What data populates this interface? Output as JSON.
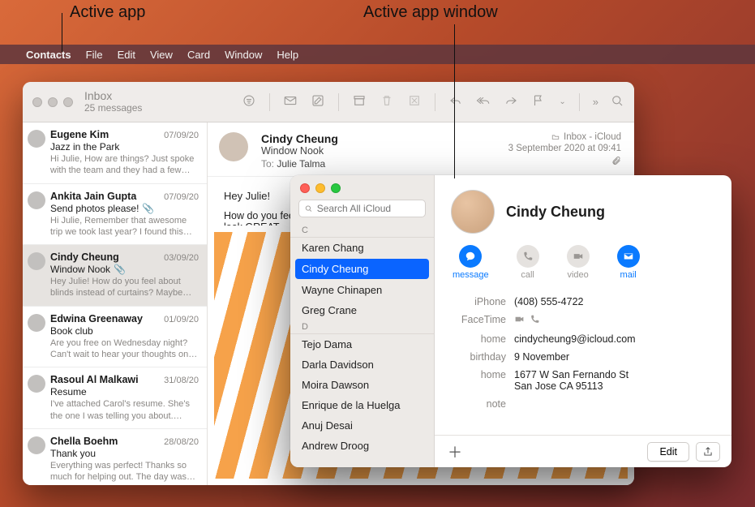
{
  "callouts": {
    "left": "Active app",
    "right": "Active app window"
  },
  "menubar": {
    "app": "Contacts",
    "items": [
      "File",
      "Edit",
      "View",
      "Card",
      "Window",
      "Help"
    ]
  },
  "mail": {
    "title": "Inbox",
    "subtitle": "25 messages",
    "header": {
      "from": "Cindy Cheung",
      "subject": "Window Nook",
      "to_label": "To:",
      "to": "Julie Talma",
      "mailbox": "Inbox - iCloud",
      "date": "3 September 2020 at 09:41"
    },
    "body_line1": "Hey Julie!",
    "body_line2": "How do you feel about blinds instead of curtains? Maybe a sheer roller? I think they'd look GREAT…",
    "messages": [
      {
        "from": "Eugene Kim",
        "date": "07/09/20",
        "subject": "Jazz in the Park",
        "preview": "Hi Julie, How are things? Just spoke with the team and they had a few co…",
        "attach": false,
        "selected": false
      },
      {
        "from": "Ankita Jain Gupta",
        "date": "07/09/20",
        "subject": "Send photos please!",
        "preview": "Hi Julie, Remember that awesome trip we took last year? I found this pictur…",
        "attach": true,
        "selected": false
      },
      {
        "from": "Cindy Cheung",
        "date": "03/09/20",
        "subject": "Window Nook",
        "preview": "Hey Julie! How do you feel about blinds instead of curtains? Maybe a…",
        "attach": true,
        "selected": true
      },
      {
        "from": "Edwina Greenaway",
        "date": "01/09/20",
        "subject": "Book club",
        "preview": "Are you free on Wednesday night? Can't wait to hear your thoughts on t…",
        "attach": false,
        "selected": false
      },
      {
        "from": "Rasoul Al Malkawi",
        "date": "31/08/20",
        "subject": "Resume",
        "preview": "I've attached Carol's resume. She's the one I was telling you about. She…",
        "attach": false,
        "selected": false
      },
      {
        "from": "Chella Boehm",
        "date": "28/08/20",
        "subject": "Thank you",
        "preview": "Everything was perfect! Thanks so much for helping out. The day was a…",
        "attach": false,
        "selected": false
      }
    ]
  },
  "contacts": {
    "search_placeholder": "Search All iCloud",
    "sections": [
      {
        "letter": "C",
        "rows": [
          {
            "name": "Karen Chang",
            "selected": false
          },
          {
            "name": "Cindy Cheung",
            "selected": true
          },
          {
            "name": "Wayne Chinapen",
            "selected": false
          },
          {
            "name": "Greg Crane",
            "selected": false
          }
        ]
      },
      {
        "letter": "D",
        "rows": [
          {
            "name": "Tejo Dama",
            "selected": false
          },
          {
            "name": "Darla Davidson",
            "selected": false
          },
          {
            "name": "Moira Dawson",
            "selected": false
          },
          {
            "name": "Enrique de la Huelga",
            "selected": false
          },
          {
            "name": "Anuj Desai",
            "selected": false
          },
          {
            "name": "Andrew Droog",
            "selected": false
          }
        ]
      }
    ],
    "card": {
      "name": "Cindy Cheung",
      "actions": {
        "message": "message",
        "call": "call",
        "video": "video",
        "mail": "mail"
      },
      "fields": [
        {
          "label": "iPhone",
          "value": "(408) 555-4722",
          "type": "text"
        },
        {
          "label": "FaceTime",
          "value": "",
          "type": "facetime"
        },
        {
          "label": "home",
          "value": "cindycheung9@icloud.com",
          "type": "text"
        },
        {
          "label": "birthday",
          "value": "9 November",
          "type": "text"
        },
        {
          "label": "home",
          "value": "1677 W San Fernando St\nSan Jose CA 95113",
          "type": "text"
        },
        {
          "label": "note",
          "value": "",
          "type": "text"
        }
      ],
      "edit": "Edit"
    }
  }
}
